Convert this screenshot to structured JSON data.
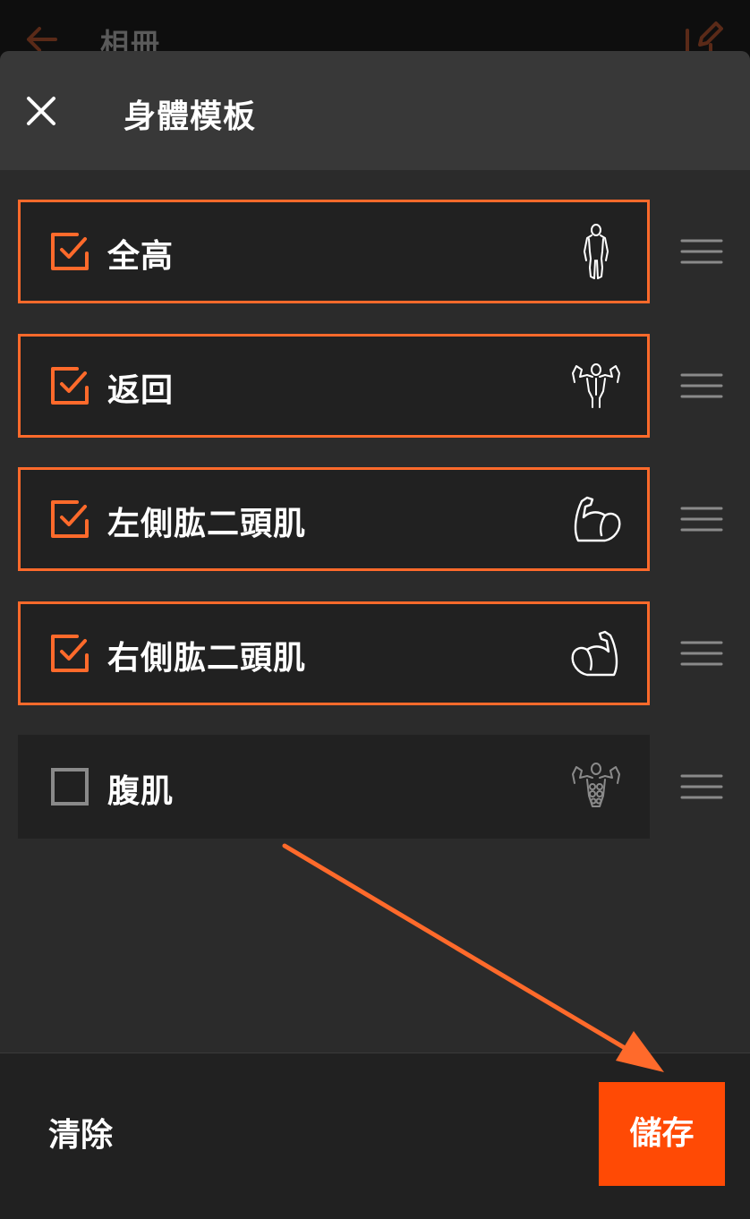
{
  "background_app": {
    "title": "相冊",
    "back_icon": "arrow-left-icon",
    "edit_icon": "edit-icon"
  },
  "sheet": {
    "title": "身體模板",
    "close_icon": "close-icon"
  },
  "templates": [
    {
      "label": "全高",
      "checked": true,
      "icon": "full-body-icon"
    },
    {
      "label": "返回",
      "checked": true,
      "icon": "back-muscles-icon"
    },
    {
      "label": "左側肱二頭肌",
      "checked": true,
      "icon": "left-biceps-icon"
    },
    {
      "label": "右側肱二頭肌",
      "checked": true,
      "icon": "right-biceps-icon"
    },
    {
      "label": "腹肌",
      "checked": false,
      "icon": "abs-icon"
    }
  ],
  "actions": {
    "clear_label": "清除",
    "save_label": "儲存"
  },
  "colors": {
    "accent": "#ff6a2b",
    "save_button": "#ff4a05",
    "row_background": "#212121",
    "sheet_background": "#2b2b2b",
    "header_background": "#383838"
  }
}
